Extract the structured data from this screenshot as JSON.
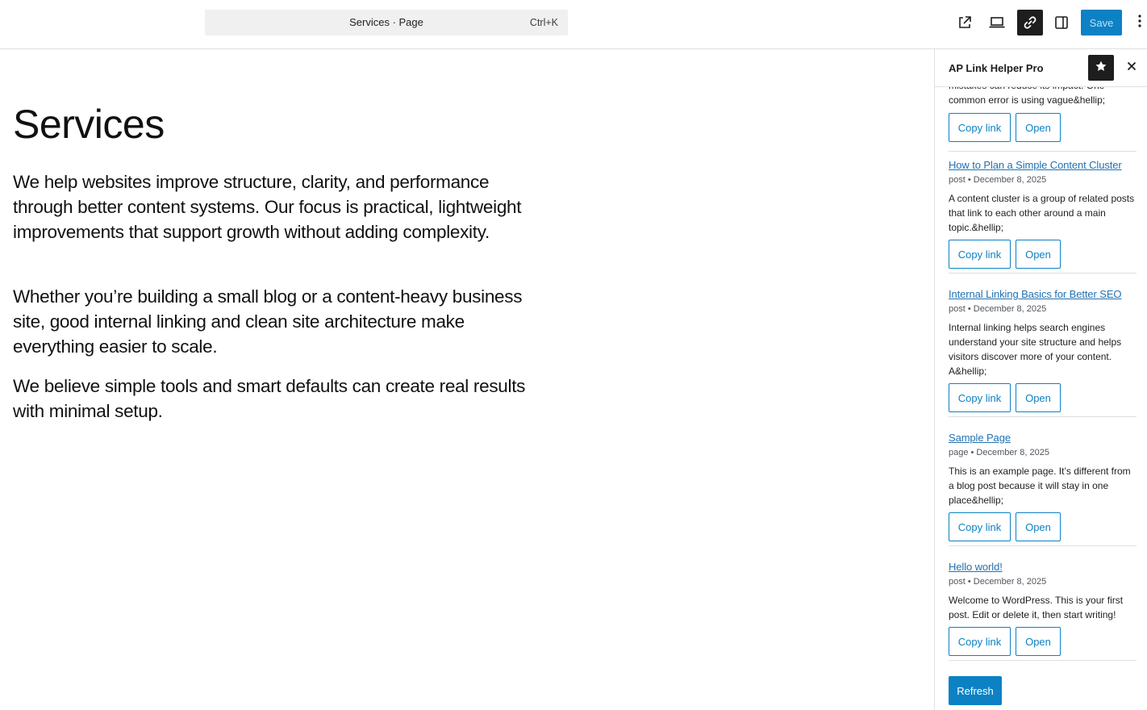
{
  "toolbar": {
    "document_title": "Services · Page",
    "shortcut": "Ctrl+K",
    "save_label": "Save",
    "icons": [
      "external-link-icon",
      "laptop-preview-icon",
      "link-icon",
      "sidebar-toggle-icon",
      "more-options-icon"
    ]
  },
  "editor": {
    "heading": "Services",
    "paragraphs": [
      "We help websites improve structure, clarity, and performance through better content systems. Our focus is practical, lightweight improvements that support growth without adding complexity.",
      "Whether you’re building a small blog or a content-heavy business site, good internal linking and clean site architecture make everything easier to scale.",
      "We believe simple tools and smart defaults can create real results with minimal setup."
    ]
  },
  "sidebar": {
    "title": "AP Link Helper Pro",
    "partial_excerpt": "mistakes can reduce its impact. One common error is using vague&hellip;",
    "copy_label": "Copy link",
    "open_label": "Open",
    "refresh_label": "Refresh",
    "posts": [
      {
        "title": "How to Plan a Simple Content Cluster",
        "meta": "post • December 8, 2025",
        "excerpt": "A content cluster is a group of related posts that link to each other around a main topic.&hellip;"
      },
      {
        "title": "Internal Linking Basics for Better SEO",
        "meta": "post • December 8, 2025",
        "excerpt": "Internal linking helps search engines understand your site structure and helps visitors discover more of your content. A&hellip;"
      },
      {
        "title": "Sample Page",
        "meta": "page • December 8, 2025",
        "excerpt": "This is an example page. It’s different from a blog post because it will stay in one place&hellip;"
      },
      {
        "title": "Hello world!",
        "meta": "post • December 8, 2025",
        "excerpt": "Welcome to WordPress. This is your first post. Edit or delete it, then start writing!"
      }
    ]
  },
  "colors": {
    "accent": "#0c81c4",
    "link": "#2271b1",
    "active_tool": "#1e1e1e",
    "border": "#e0e0e0"
  }
}
